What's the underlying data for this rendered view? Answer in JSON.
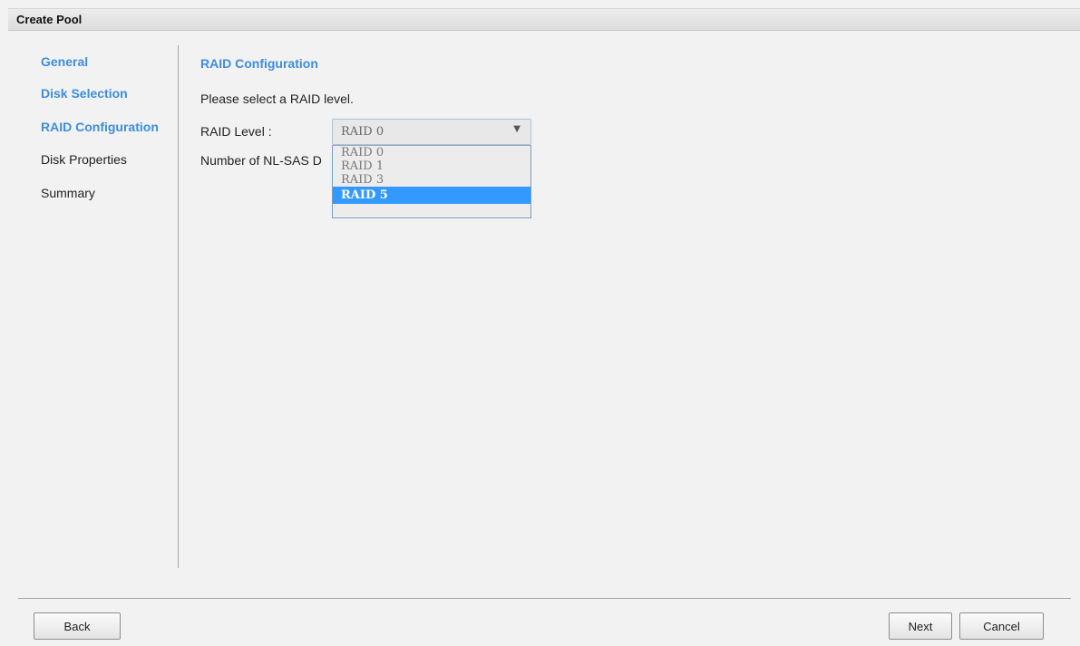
{
  "window": {
    "title": "Create Pool"
  },
  "wizard_nav": {
    "items": [
      {
        "label": "General",
        "state": "done"
      },
      {
        "label": "Disk Selection",
        "state": "done"
      },
      {
        "label": "RAID Configuration",
        "state": "current"
      },
      {
        "label": "Disk Properties",
        "state": "pending"
      },
      {
        "label": "Summary",
        "state": "pending"
      }
    ]
  },
  "main": {
    "section_title": "RAID Configuration",
    "instruction": "Please select a RAID level.",
    "raid_level_label": "RAID Level :",
    "disk_count_label": "Number of NL-SAS D",
    "raid_select": {
      "value": "RAID 0",
      "arrow_icon": "dropdown-arrow-icon",
      "options": [
        "RAID 0",
        "RAID 1",
        "RAID 3",
        "RAID 5"
      ],
      "highlighted": "RAID 5"
    }
  },
  "footer": {
    "back_label": "Back",
    "next_label": "Next",
    "cancel_label": "Cancel"
  },
  "colors": {
    "accent": "#3d8de0",
    "highlight": "#3399ff"
  }
}
